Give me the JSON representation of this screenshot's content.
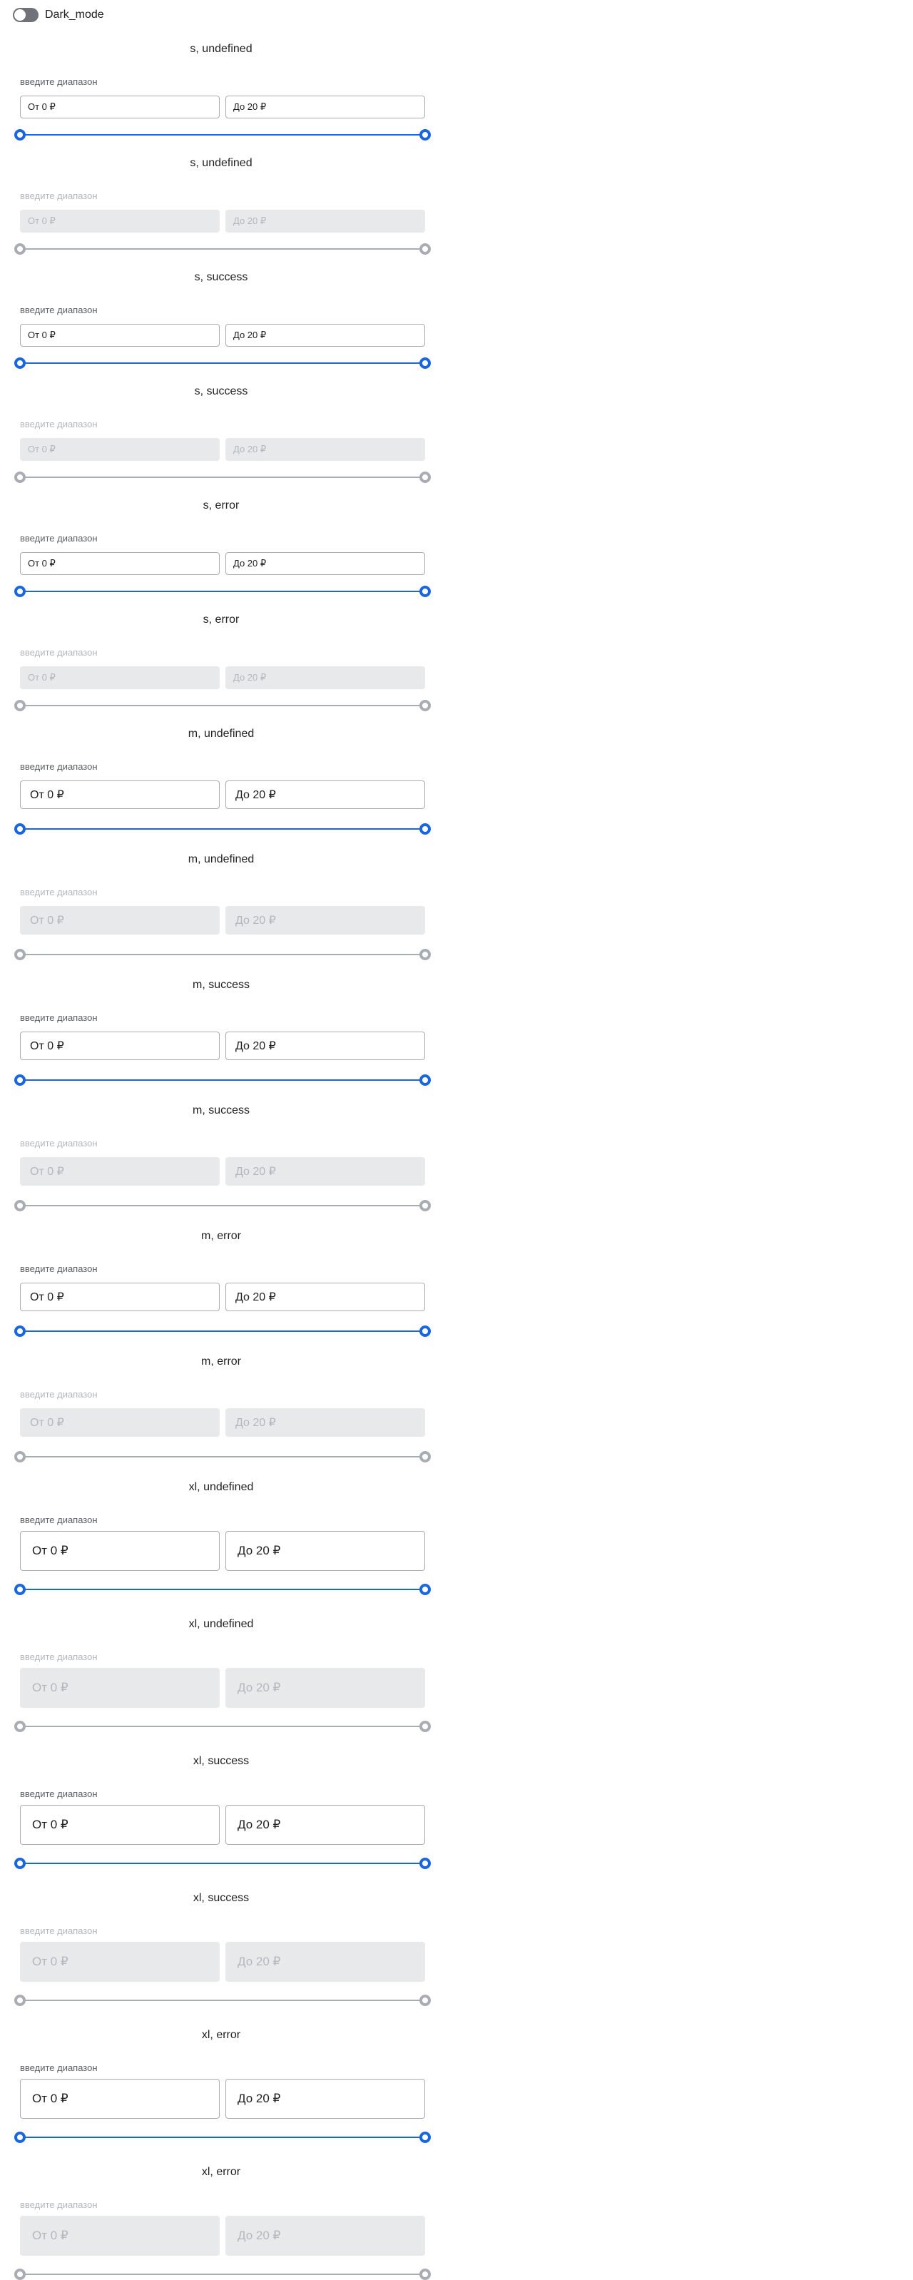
{
  "toggle": {
    "label": "Dark_mode"
  },
  "sections": [
    {
      "title": "s, undefined",
      "label": "введите диапазон",
      "from": "От 0 ₽",
      "to": "До 20 ₽"
    },
    {
      "title": "s, undefined",
      "label": "введите диапазон",
      "from": "От 0 ₽",
      "to": "До 20 ₽"
    },
    {
      "title": "s, success",
      "label": "введите диапазон",
      "from": "От 0 ₽",
      "to": "До 20 ₽"
    },
    {
      "title": "s, success",
      "label": "введите диапазон",
      "from": "От 0 ₽",
      "to": "До 20 ₽"
    },
    {
      "title": "s, error",
      "label": "введите диапазон",
      "from": "От 0 ₽",
      "to": "До 20 ₽"
    },
    {
      "title": "s, error",
      "label": "введите диапазон",
      "from": "От 0 ₽",
      "to": "До 20 ₽"
    },
    {
      "title": "m, undefined",
      "label": "введите диапазон",
      "from": "От 0 ₽",
      "to": "До 20 ₽"
    },
    {
      "title": "m, undefined",
      "label": "введите диапазон",
      "from": "От 0 ₽",
      "to": "До 20 ₽"
    },
    {
      "title": "m, success",
      "label": "введите диапазон",
      "from": "От 0 ₽",
      "to": "До 20 ₽"
    },
    {
      "title": "m, success",
      "label": "введите диапазон",
      "from": "От 0 ₽",
      "to": "До 20 ₽"
    },
    {
      "title": "m, error",
      "label": "введите диапазон",
      "from": "От 0 ₽",
      "to": "До 20 ₽"
    },
    {
      "title": "m, error",
      "label": "введите диапазон",
      "from": "От 0 ₽",
      "to": "До 20 ₽"
    },
    {
      "title": "xl, undefined",
      "label": "введите диапазон",
      "from": "От 0 ₽",
      "to": "До 20 ₽"
    },
    {
      "title": "xl, undefined",
      "label": "введите диапазон",
      "from": "От 0 ₽",
      "to": "До 20 ₽"
    },
    {
      "title": "xl, success",
      "label": "введите диапазон",
      "from": "От 0 ₽",
      "to": "До 20 ₽"
    },
    {
      "title": "xl, success",
      "label": "введите диапазон",
      "from": "От 0 ₽",
      "to": "До 20 ₽"
    },
    {
      "title": "xl, error",
      "label": "введите диапазон",
      "from": "От 0 ₽",
      "to": "До 20 ₽"
    },
    {
      "title": "xl, error",
      "label": "введите диапазон",
      "from": "От 0 ₽",
      "to": "До 20 ₽"
    }
  ]
}
